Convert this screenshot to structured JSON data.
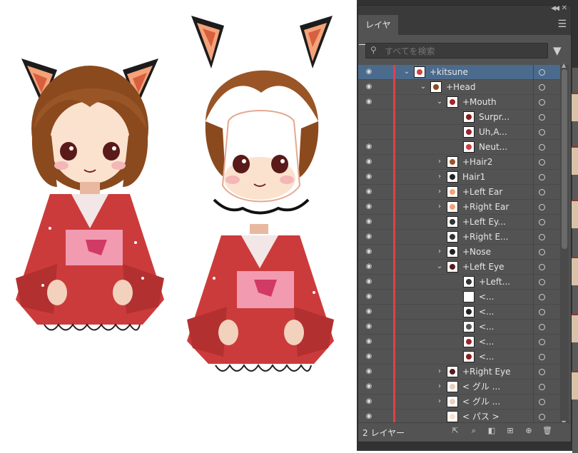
{
  "panel": {
    "tab_label": "レイヤー",
    "search_placeholder": "すべてを検索",
    "layer_count": "2 レイヤー"
  },
  "layers": [
    {
      "name": "+kitsune",
      "depth": 0,
      "twirl": "open",
      "visible": true,
      "selected": true
    },
    {
      "name": "+Head",
      "depth": 1,
      "twirl": "open",
      "visible": true
    },
    {
      "name": "+Mouth",
      "depth": 2,
      "twirl": "open",
      "visible": true
    },
    {
      "name": "Surpr...",
      "depth": 3,
      "twirl": "none",
      "visible": false
    },
    {
      "name": "Uh,A...",
      "depth": 3,
      "twirl": "none",
      "visible": false
    },
    {
      "name": "Neut...",
      "depth": 3,
      "twirl": "none",
      "visible": true
    },
    {
      "name": "+Hair2",
      "depth": 2,
      "twirl": "closed",
      "visible": true
    },
    {
      "name": "Hair1",
      "depth": 2,
      "twirl": "closed",
      "visible": true
    },
    {
      "name": "+Left Ear",
      "depth": 2,
      "twirl": "closed",
      "visible": true
    },
    {
      "name": "+Right Ear",
      "depth": 2,
      "twirl": "closed",
      "visible": true
    },
    {
      "name": "+Left Ey...",
      "depth": 2,
      "twirl": "none",
      "visible": true
    },
    {
      "name": "+Right E...",
      "depth": 2,
      "twirl": "none",
      "visible": true
    },
    {
      "name": "+Nose",
      "depth": 2,
      "twirl": "closed",
      "visible": true
    },
    {
      "name": "+Left Eye",
      "depth": 2,
      "twirl": "open",
      "visible": true
    },
    {
      "name": "+Left...",
      "depth": 3,
      "twirl": "none",
      "visible": true
    },
    {
      "name": "<...",
      "depth": 3,
      "twirl": "none",
      "visible": true
    },
    {
      "name": "<...",
      "depth": 3,
      "twirl": "none",
      "visible": true
    },
    {
      "name": "<...",
      "depth": 3,
      "twirl": "none",
      "visible": true
    },
    {
      "name": "<...",
      "depth": 3,
      "twirl": "none",
      "visible": true
    },
    {
      "name": "<...",
      "depth": 3,
      "twirl": "none",
      "visible": true
    },
    {
      "name": "+Right Eye",
      "depth": 2,
      "twirl": "closed",
      "visible": true
    },
    {
      "name": "< グル ...",
      "depth": 2,
      "twirl": "closed",
      "visible": true
    },
    {
      "name": "< グル ...",
      "depth": 2,
      "twirl": "closed",
      "visible": true
    },
    {
      "name": "< パス >",
      "depth": 2,
      "twirl": "none",
      "visible": true
    }
  ],
  "colors": {
    "layer_color": "#e0404a",
    "selection": "#4b6b8d",
    "panel_bg": "#535353"
  }
}
